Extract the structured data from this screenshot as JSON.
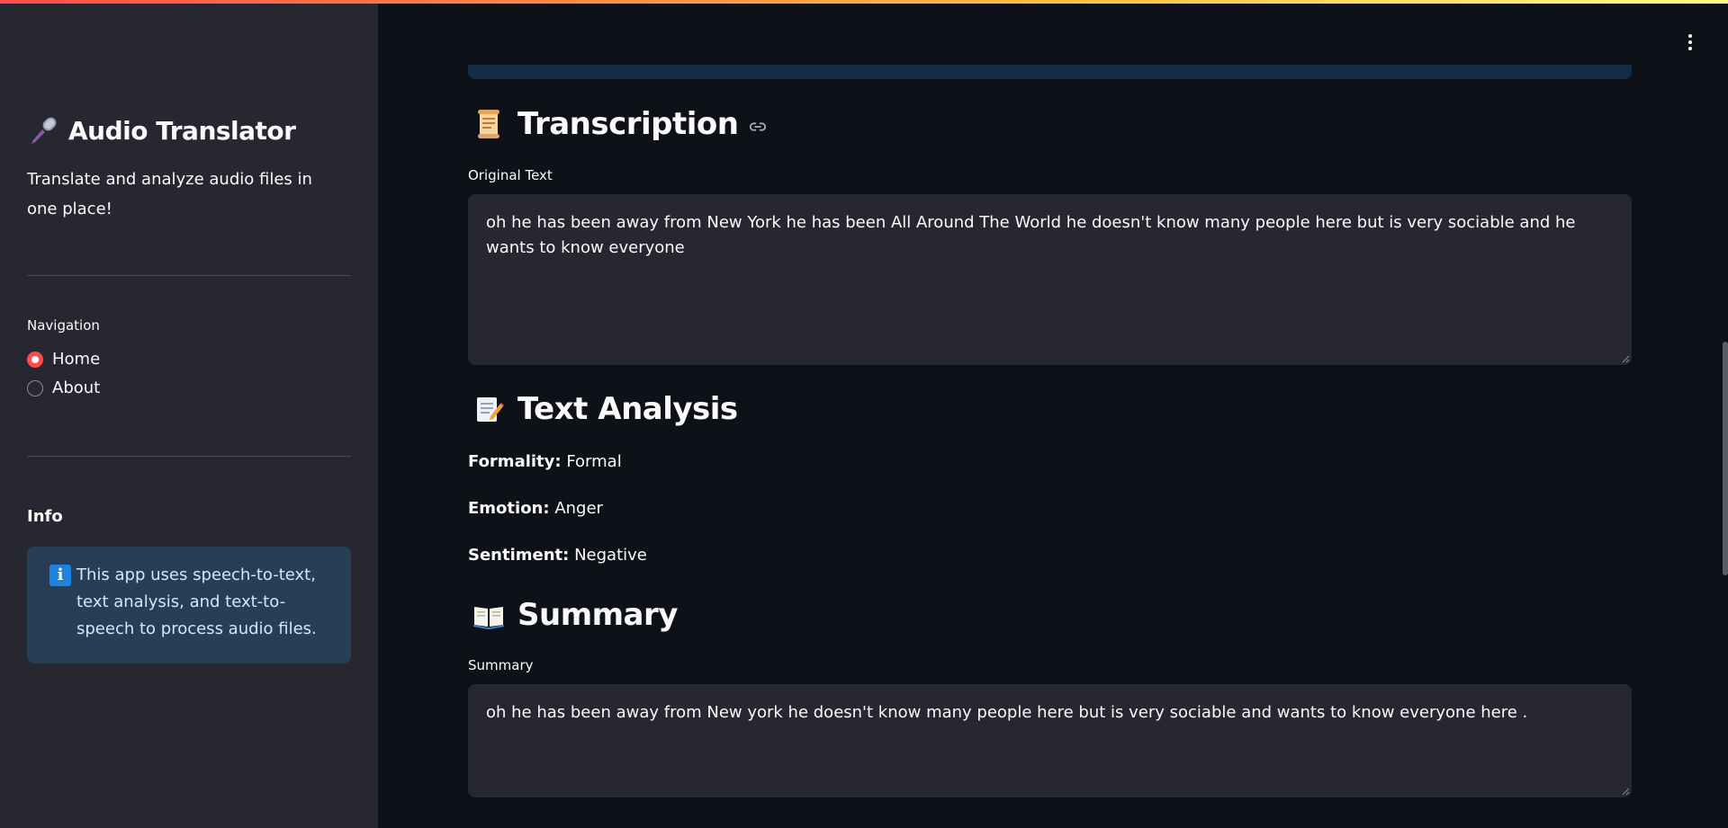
{
  "sidebar": {
    "title": "Audio Translator",
    "subtitle": "Translate and analyze audio files in one place!",
    "nav_label": "Navigation",
    "nav_items": [
      {
        "label": "Home",
        "selected": true
      },
      {
        "label": "About",
        "selected": false
      }
    ],
    "info_heading": "Info",
    "info_text": "This app uses speech-to-text, text analysis, and text-to-speech to process audio files."
  },
  "main": {
    "transcription": {
      "heading": "Transcription",
      "label": "Original Text",
      "value": "oh he has been away from New York he has been All Around The World he doesn't know many people here but is very sociable and he wants to know everyone"
    },
    "analysis": {
      "heading": "Text Analysis",
      "formality_label": "Formality:",
      "formality_value": "Formal",
      "emotion_label": "Emotion:",
      "emotion_value": "Anger",
      "sentiment_label": "Sentiment:",
      "sentiment_value": "Negative"
    },
    "summary": {
      "heading": "Summary",
      "label": "Summary",
      "value": "oh he has been away from New york he doesn't know many people here but is very sociable and wants to know everyone here ."
    }
  },
  "colors": {
    "background": "#0e1117",
    "sidebar": "#262730",
    "accent": "#ff4b4b",
    "info_box": "#283d56"
  },
  "icons": {
    "title": "microphone-icon",
    "transcription": "scroll-icon",
    "analysis": "memo-icon",
    "summary": "open-book-icon",
    "info": "information-icon",
    "menu": "kebab-menu-icon"
  }
}
